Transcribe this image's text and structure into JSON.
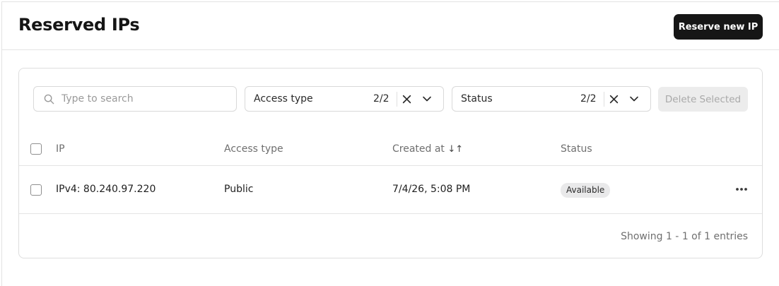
{
  "header": {
    "title": "Reserved IPs",
    "primary_button": "Reserve new IP"
  },
  "toolbar": {
    "search_placeholder": "Type to search",
    "filters": [
      {
        "label": "Access type",
        "count": "2/2"
      },
      {
        "label": "Status",
        "count": "2/2"
      }
    ],
    "delete_button": "Delete Selected"
  },
  "table": {
    "columns": [
      "IP",
      "Access type",
      "Created at",
      "Status"
    ],
    "sort_indicator": "↓↑",
    "rows": [
      {
        "ip": "IPv4: 80.240.97.220",
        "access_type": "Public",
        "created_at": "7/4/26, 5:08 PM",
        "status": "Available"
      }
    ],
    "footer": "Showing 1 - 1 of 1 entries"
  },
  "colors": {
    "primary_button_bg": "#161616",
    "badge_bg": "#e9e9ea",
    "disabled_button_bg": "#ececec"
  },
  "icons": [
    "search-icon",
    "close-icon",
    "chevron-down-icon",
    "sort-icon",
    "more-horizontal-icon"
  ]
}
